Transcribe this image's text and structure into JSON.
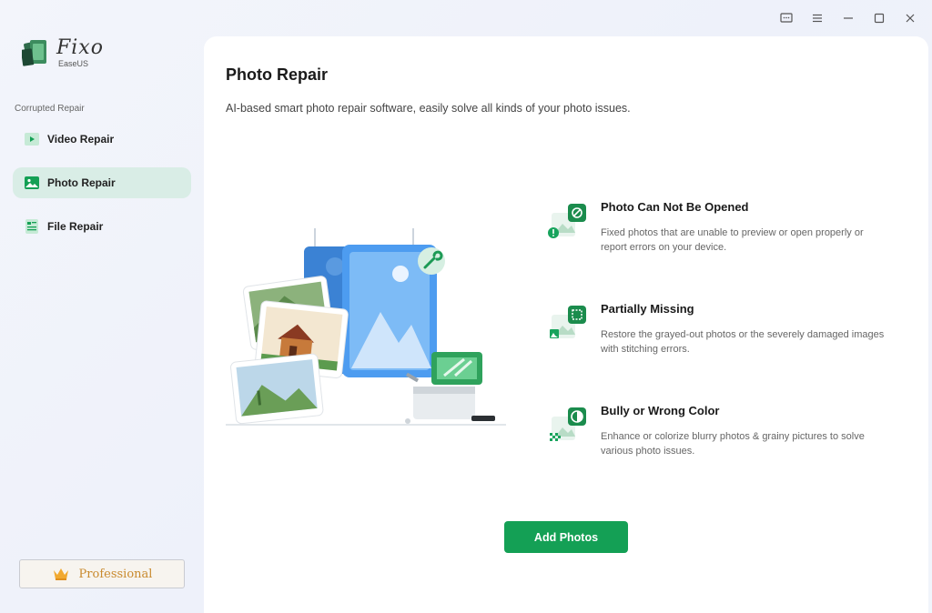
{
  "app": {
    "name": "Fixo",
    "vendor": "EaseUS"
  },
  "window_controls": [
    "feedback-icon",
    "menu-icon",
    "minimize-icon",
    "maximize-icon",
    "close-icon"
  ],
  "sidebar": {
    "section_label": "Corrupted Repair",
    "items": [
      {
        "label": "Video Repair",
        "icon": "video-icon",
        "active": false
      },
      {
        "label": "Photo Repair",
        "icon": "photo-icon",
        "active": true
      },
      {
        "label": "File Repair",
        "icon": "file-icon",
        "active": false
      }
    ],
    "pro_label": "Professional"
  },
  "main": {
    "title": "Photo Repair",
    "subtitle": "AI-based smart photo repair software, easily solve all kinds of your photo issues.",
    "features": [
      {
        "title": "Photo Can Not Be Opened",
        "desc": "Fixed photos that are unable to preview or open properly or report errors on your device.",
        "icon": "photo-not-open-icon"
      },
      {
        "title": "Partially Missing",
        "desc": "Restore the grayed-out photos or the severely damaged images with stitching errors.",
        "icon": "partially-missing-icon"
      },
      {
        "title": "Bully or Wrong Color",
        "desc": "Enhance or colorize blurry photos & grainy pictures to solve various photo issues.",
        "icon": "wrong-color-icon"
      }
    ],
    "add_button": "Add Photos"
  },
  "colors": {
    "accent": "#14a055",
    "active_nav": "#d9ede6",
    "pro_text": "#c98a2e"
  }
}
